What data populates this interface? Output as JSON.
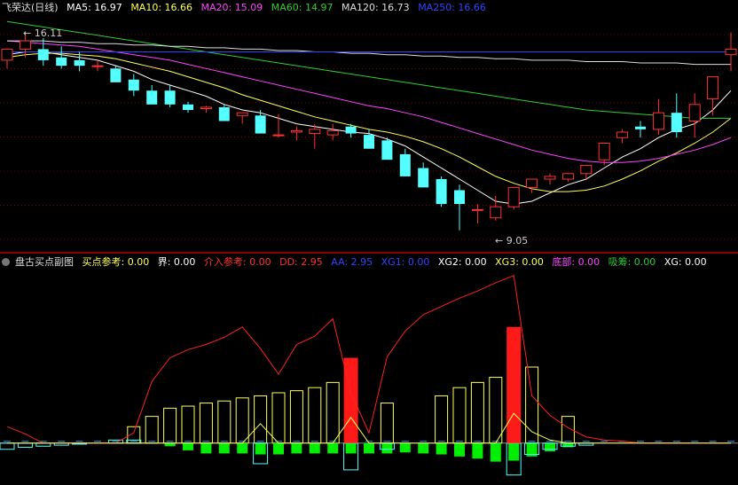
{
  "main": {
    "title": "飞荣达(日线)",
    "ma": [
      {
        "label": "MA5: 16.97",
        "color": "#ffffff"
      },
      {
        "label": "MA10: 16.66",
        "color": "#ffff55"
      },
      {
        "label": "MA20: 15.09",
        "color": "#ff44ff"
      },
      {
        "label": "MA60: 14.97",
        "color": "#33cc33"
      },
      {
        "label": "MA120: 16.73",
        "color": "#dddddd"
      },
      {
        "label": "MA250: 16.66",
        "color": "#3344ff"
      }
    ],
    "high_label": "← 16.11",
    "low_label": "← 9.05"
  },
  "sub": {
    "title": "盘古买点副图",
    "items": [
      {
        "label": "买点参考: 0.00",
        "color": "#ffff55"
      },
      {
        "label": "界: 0.00",
        "color": "#ffffff"
      },
      {
        "label": "介入参考: 0.00",
        "color": "#ff3333"
      },
      {
        "label": "DD: 2.95",
        "color": "#ff3333"
      },
      {
        "label": "AA: 2.95",
        "color": "#3344ff"
      },
      {
        "label": "XG1: 0.00",
        "color": "#3344ff"
      },
      {
        "label": "XG2: 0.00",
        "color": "#ffffff"
      },
      {
        "label": "XG3: 0.00",
        "color": "#ffff55"
      },
      {
        "label": "底部: 0.00",
        "color": "#ff44ff"
      },
      {
        "label": "吸筹: 0.00",
        "color": "#33cc33"
      },
      {
        "label": "XG: 0.00",
        "color": "#ffffff"
      }
    ]
  },
  "chart_data": [
    {
      "type": "candlestick",
      "title": "飞荣达(日线)",
      "x": [
        1,
        2,
        3,
        4,
        5,
        6,
        7,
        8,
        9,
        10,
        11,
        12,
        13,
        14,
        15,
        16,
        17,
        18,
        19,
        20,
        21,
        22,
        23,
        24,
        25,
        26,
        27,
        28,
        29,
        30,
        31,
        32,
        33,
        34,
        35,
        36,
        37,
        38,
        39,
        40,
        41
      ],
      "open": [
        15.2,
        15.6,
        15.6,
        15.3,
        15.2,
        15.0,
        14.9,
        14.5,
        14.1,
        14.1,
        13.6,
        13.45,
        13.5,
        13.2,
        13.2,
        12.5,
        12.6,
        12.55,
        12.5,
        12.8,
        12.5,
        12.3,
        11.8,
        11.3,
        10.9,
        10.5,
        9.8,
        9.5,
        9.9,
        10.6,
        10.9,
        10.9,
        11.1,
        11.6,
        12.4,
        12.8,
        12.7,
        13.3,
        13.0,
        13.8,
        15.4
      ],
      "high": [
        15.5,
        16.2,
        16.0,
        15.7,
        15.5,
        15.2,
        15.0,
        14.7,
        14.3,
        14.3,
        13.7,
        13.55,
        13.6,
        13.3,
        13.4,
        13.25,
        12.8,
        12.9,
        12.9,
        12.9,
        12.7,
        12.4,
        12.0,
        11.5,
        11.0,
        10.7,
        10.0,
        10.3,
        10.6,
        10.9,
        11.1,
        11.1,
        11.3,
        12.0,
        12.7,
        13.0,
        13.8,
        14.0,
        14.0,
        14.5,
        16.2
      ],
      "low": [
        14.9,
        15.3,
        15.0,
        14.9,
        14.8,
        14.8,
        14.5,
        13.9,
        13.9,
        13.5,
        13.3,
        13.3,
        13.1,
        12.9,
        12.7,
        12.4,
        12.3,
        12.0,
        12.3,
        12.4,
        12.0,
        11.7,
        11.0,
        10.6,
        9.9,
        9.05,
        9.3,
        9.4,
        9.8,
        10.4,
        10.7,
        10.8,
        10.9,
        11.4,
        12.2,
        12.4,
        12.5,
        12.4,
        12.4,
        13.2,
        14.8
      ],
      "close": [
        15.6,
        15.9,
        15.2,
        15.0,
        15.0,
        15.0,
        14.4,
        14.1,
        13.6,
        13.6,
        13.4,
        13.5,
        13.0,
        13.3,
        12.55,
        12.5,
        12.65,
        12.7,
        12.65,
        12.55,
        12.0,
        11.6,
        11.0,
        10.6,
        10.0,
        10.0,
        9.8,
        9.9,
        10.6,
        10.9,
        11.0,
        11.1,
        11.4,
        12.2,
        12.6,
        12.7,
        13.3,
        12.6,
        13.6,
        14.6,
        15.6
      ],
      "ma_lines": [
        {
          "name": "MA5",
          "color": "#ffffff",
          "values": [
            15.4,
            15.5,
            15.5,
            15.4,
            15.3,
            15.2,
            15.0,
            14.8,
            14.5,
            14.3,
            14.1,
            13.9,
            13.6,
            13.4,
            13.3,
            13.1,
            12.9,
            12.8,
            12.7,
            12.6,
            12.55,
            12.35,
            12.1,
            11.7,
            11.3,
            10.9,
            10.5,
            10.1,
            10.0,
            10.1,
            10.4,
            10.7,
            10.9,
            11.3,
            11.7,
            12.0,
            12.4,
            12.7,
            12.9,
            13.4,
            14.1
          ]
        },
        {
          "name": "MA10",
          "color": "#ffff55",
          "values": [
            15.3,
            15.4,
            15.45,
            15.45,
            15.4,
            15.35,
            15.25,
            15.1,
            14.95,
            14.8,
            14.6,
            14.4,
            14.2,
            13.95,
            13.75,
            13.55,
            13.35,
            13.15,
            13.0,
            12.85,
            12.7,
            12.6,
            12.45,
            12.25,
            12.0,
            11.7,
            11.35,
            11.0,
            10.75,
            10.55,
            10.45,
            10.45,
            10.5,
            10.65,
            10.9,
            11.2,
            11.55,
            11.85,
            12.2,
            12.6,
            13.1
          ]
        },
        {
          "name": "MA20",
          "color": "#ff44ff",
          "values": [
            15.9,
            15.85,
            15.8,
            15.75,
            15.7,
            15.6,
            15.5,
            15.4,
            15.3,
            15.2,
            15.05,
            14.9,
            14.75,
            14.6,
            14.45,
            14.3,
            14.15,
            14.0,
            13.85,
            13.7,
            13.55,
            13.45,
            13.3,
            13.15,
            12.95,
            12.75,
            12.55,
            12.35,
            12.15,
            11.95,
            11.8,
            11.65,
            11.55,
            11.5,
            11.5,
            11.55,
            11.65,
            11.8,
            11.95,
            12.15,
            12.4
          ]
        },
        {
          "name": "MA60",
          "color": "#33cc33",
          "values": [
            16.6,
            16.5,
            16.4,
            16.3,
            16.2,
            16.1,
            16.0,
            15.9,
            15.8,
            15.7,
            15.6,
            15.5,
            15.4,
            15.3,
            15.2,
            15.1,
            15.0,
            14.9,
            14.8,
            14.7,
            14.6,
            14.5,
            14.4,
            14.3,
            14.2,
            14.1,
            14.0,
            13.9,
            13.8,
            13.7,
            13.6,
            13.5,
            13.4,
            13.35,
            13.3,
            13.25,
            13.2,
            13.15,
            13.1,
            13.1,
            13.1
          ]
        },
        {
          "name": "MA120",
          "color": "#dddddd",
          "values": [
            15.9,
            15.9,
            15.9,
            15.85,
            15.85,
            15.8,
            15.8,
            15.75,
            15.75,
            15.7,
            15.7,
            15.65,
            15.65,
            15.6,
            15.6,
            15.55,
            15.55,
            15.5,
            15.5,
            15.45,
            15.45,
            15.4,
            15.4,
            15.35,
            15.35,
            15.3,
            15.3,
            15.25,
            15.25,
            15.2,
            15.2,
            15.2,
            15.15,
            15.15,
            15.15,
            15.1,
            15.1,
            15.1,
            15.05,
            15.05,
            15.05
          ]
        },
        {
          "name": "MA250",
          "color": "#3344ff",
          "values": [
            15.5,
            15.5,
            15.5,
            15.5,
            15.5,
            15.5,
            15.5,
            15.5,
            15.5,
            15.5,
            15.5,
            15.5,
            15.5,
            15.5,
            15.5,
            15.5,
            15.5,
            15.5,
            15.5,
            15.5,
            15.5,
            15.5,
            15.5,
            15.5,
            15.5,
            15.5,
            15.5,
            15.5,
            15.5,
            15.5,
            15.5,
            15.5,
            15.5,
            15.5,
            15.5,
            15.5,
            15.5,
            15.5,
            15.5,
            15.5,
            15.5
          ]
        }
      ],
      "ylim": [
        8.4,
        16.8
      ]
    },
    {
      "type": "bar",
      "title": "盘古买点副图",
      "x": [
        1,
        2,
        3,
        4,
        5,
        6,
        7,
        8,
        9,
        10,
        11,
        12,
        13,
        14,
        15,
        16,
        17,
        18,
        19,
        20,
        21,
        22,
        23,
        24,
        25,
        26,
        27,
        28,
        29,
        30,
        31,
        32,
        33,
        34,
        35,
        36,
        37,
        38,
        39,
        40,
        41
      ],
      "yellow_bars": [
        0,
        0,
        0,
        0,
        0,
        0,
        0,
        1.6,
        2.6,
        3.4,
        3.6,
        3.9,
        4.1,
        4.4,
        4.6,
        4.9,
        5.1,
        5.4,
        5.9,
        6.6,
        0,
        3.9,
        0,
        0,
        4.6,
        5.4,
        5.9,
        6.4,
        6.9,
        7.4,
        0,
        2.6,
        0,
        0,
        0,
        0,
        0,
        0,
        0,
        0,
        0
      ],
      "red_bars": [
        0,
        0,
        0,
        0,
        0,
        0,
        0,
        0,
        0,
        0,
        0,
        0,
        0,
        0,
        0,
        0,
        0,
        0,
        0,
        8.3,
        0,
        0,
        0,
        0,
        0,
        0,
        0,
        0,
        11.3,
        0,
        0,
        0,
        0,
        0,
        0,
        0,
        0,
        0,
        0,
        0,
        0
      ],
      "green_bars": [
        0,
        0,
        0,
        0,
        0,
        0,
        0,
        0,
        0,
        -0.3,
        -0.7,
        -1.0,
        -1.0,
        -1.0,
        -1.1,
        -1.1,
        -1.0,
        -1.0,
        -1.0,
        -1.0,
        -1.0,
        -1.0,
        -0.9,
        -1.0,
        -1.1,
        -1.3,
        -1.5,
        -1.8,
        -1.7,
        -1.3,
        -0.8,
        -0.4,
        0,
        0,
        0,
        0,
        0,
        0,
        0,
        0,
        0
      ],
      "cyan_bars": [
        -0.6,
        -0.4,
        -0.3,
        -0.2,
        -0.1,
        0,
        0.3,
        0.3,
        0,
        0,
        0,
        0,
        0,
        0,
        -2.0,
        0,
        0,
        0,
        0,
        -2.6,
        0,
        -0.6,
        0,
        0,
        0,
        0,
        0,
        0,
        -3.1,
        -1.1,
        -0.6,
        -0.3,
        -0.2,
        0,
        0,
        0,
        0,
        0,
        0,
        0,
        0
      ],
      "red_line": [
        1.6,
        0.9,
        0,
        0,
        0,
        0,
        0,
        1,
        6,
        8.3,
        9.1,
        9.6,
        10.3,
        11.3,
        9.2,
        6.7,
        9.6,
        10.4,
        12.1,
        4.9,
        1,
        8.4,
        10.9,
        12.5,
        13.3,
        14.1,
        14.8,
        15.6,
        16.3,
        4.6,
        2.7,
        1.5,
        0.6,
        0.3,
        0.2,
        0,
        0,
        0,
        0,
        0,
        0
      ],
      "yellow_line": [
        0,
        0,
        0,
        0,
        0,
        0,
        0,
        0,
        0,
        0,
        0,
        0,
        0,
        0,
        1.9,
        0,
        0,
        0,
        0,
        2.5,
        0,
        0,
        0,
        0,
        0,
        0,
        0,
        0,
        2.9,
        1.1,
        0.3,
        0,
        0,
        0,
        0,
        0,
        0,
        0,
        0,
        0,
        0
      ],
      "ylim": [
        -3.9,
        16.8
      ]
    }
  ]
}
